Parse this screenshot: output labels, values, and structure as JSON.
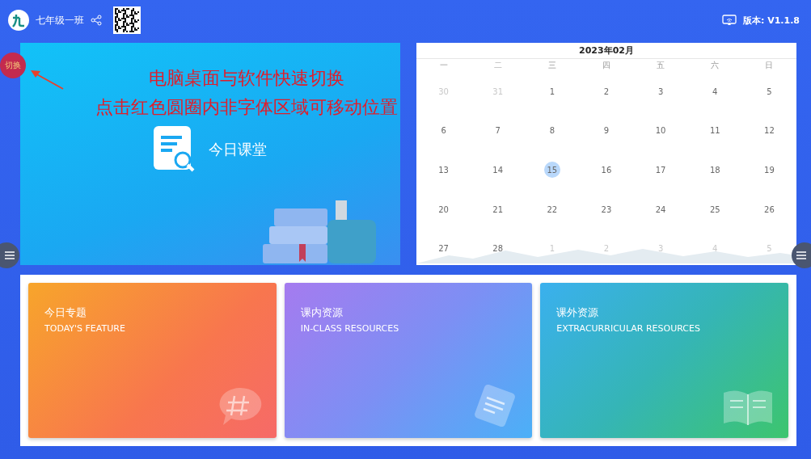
{
  "header": {
    "class_name": "七年级一班",
    "version": "版本: V1.1.8"
  },
  "switch_button": {
    "label": "切换"
  },
  "annotation": [
    "电脑桌面与软件快速切换",
    "点击红色圆圈内非字体区域可移动位置"
  ],
  "today_class": {
    "label": "今日课堂"
  },
  "calendar": {
    "title": "2023年02月",
    "weekdays": [
      "一",
      "二",
      "三",
      "四",
      "五",
      "六",
      "日"
    ],
    "weeks": [
      [
        {
          "day": "30",
          "outside": true,
          "selected": false
        },
        {
          "day": "31",
          "outside": true,
          "selected": false
        },
        {
          "day": "1",
          "outside": false,
          "selected": false
        },
        {
          "day": "2",
          "outside": false,
          "selected": false
        },
        {
          "day": "3",
          "outside": false,
          "selected": false
        },
        {
          "day": "4",
          "outside": false,
          "selected": false
        },
        {
          "day": "5",
          "outside": false,
          "selected": false
        }
      ],
      [
        {
          "day": "6",
          "outside": false,
          "selected": false
        },
        {
          "day": "7",
          "outside": false,
          "selected": false
        },
        {
          "day": "8",
          "outside": false,
          "selected": false
        },
        {
          "day": "9",
          "outside": false,
          "selected": false
        },
        {
          "day": "10",
          "outside": false,
          "selected": false
        },
        {
          "day": "11",
          "outside": false,
          "selected": false
        },
        {
          "day": "12",
          "outside": false,
          "selected": false
        }
      ],
      [
        {
          "day": "13",
          "outside": false,
          "selected": false
        },
        {
          "day": "14",
          "outside": false,
          "selected": false
        },
        {
          "day": "15",
          "outside": false,
          "selected": true
        },
        {
          "day": "16",
          "outside": false,
          "selected": false
        },
        {
          "day": "17",
          "outside": false,
          "selected": false
        },
        {
          "day": "18",
          "outside": false,
          "selected": false
        },
        {
          "day": "19",
          "outside": false,
          "selected": false
        }
      ],
      [
        {
          "day": "20",
          "outside": false,
          "selected": false
        },
        {
          "day": "21",
          "outside": false,
          "selected": false
        },
        {
          "day": "22",
          "outside": false,
          "selected": false
        },
        {
          "day": "23",
          "outside": false,
          "selected": false
        },
        {
          "day": "24",
          "outside": false,
          "selected": false
        },
        {
          "day": "25",
          "outside": false,
          "selected": false
        },
        {
          "day": "26",
          "outside": false,
          "selected": false
        }
      ],
      [
        {
          "day": "27",
          "outside": false,
          "selected": false
        },
        {
          "day": "28",
          "outside": false,
          "selected": false
        },
        {
          "day": "1",
          "outside": true,
          "selected": false
        },
        {
          "day": "2",
          "outside": true,
          "selected": false
        },
        {
          "day": "3",
          "outside": true,
          "selected": false
        },
        {
          "day": "4",
          "outside": true,
          "selected": false
        },
        {
          "day": "5",
          "outside": true,
          "selected": false
        }
      ]
    ]
  },
  "cards": [
    {
      "title": "今日专题",
      "subtitle": "TODAY'S FEATURE",
      "kind": "feature"
    },
    {
      "title": "课内资源",
      "subtitle": "IN-CLASS RESOURCES",
      "kind": "inclass"
    },
    {
      "title": "课外资源",
      "subtitle": "EXTRACURRICULAR RESOURCES",
      "kind": "extra"
    }
  ]
}
